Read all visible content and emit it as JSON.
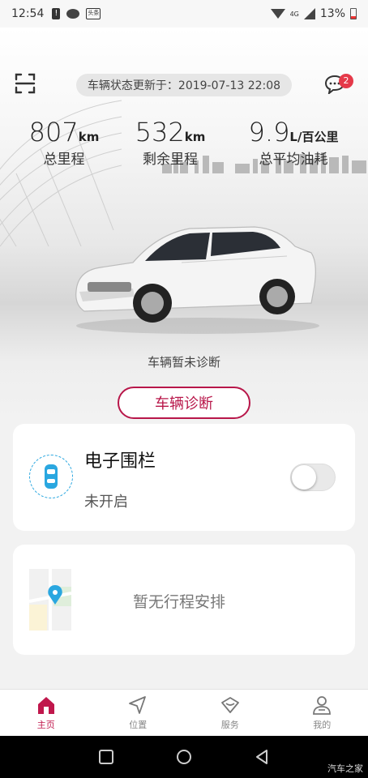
{
  "statusbar": {
    "time": "12:54",
    "toutiao": "头条",
    "battery": "13%",
    "network": "4G"
  },
  "header": {
    "status_text": "车辆状态更新于：2019-07-13 22:08",
    "message_badge": "2",
    "icons": {
      "scan": "scan-icon",
      "message": "chat-bubble-icon"
    }
  },
  "stats": [
    {
      "value": "807",
      "unit": "km",
      "label": "总里程"
    },
    {
      "value": "532",
      "unit": "km",
      "label": "剩余里程"
    },
    {
      "value": "9.9",
      "unit": "L/百公里",
      "label": "总平均油耗"
    }
  ],
  "diagnosis": {
    "status": "车辆暂未诊断",
    "button": "车辆诊断"
  },
  "fence": {
    "title": "电子围栏",
    "state": "未开启",
    "enabled": false
  },
  "trip": {
    "text": "暂无行程安排"
  },
  "bottom_nav": [
    {
      "label": "主页",
      "icon": "home-icon",
      "active": true
    },
    {
      "label": "位置",
      "icon": "location-arrow-icon",
      "active": false
    },
    {
      "label": "服务",
      "icon": "service-icon",
      "active": false
    },
    {
      "label": "我的",
      "icon": "user-icon",
      "active": false
    }
  ],
  "watermark": "汽车之家",
  "colors": {
    "accent": "#c0174c",
    "fence_blue": "#2aa7e0",
    "badge": "#e53949"
  }
}
